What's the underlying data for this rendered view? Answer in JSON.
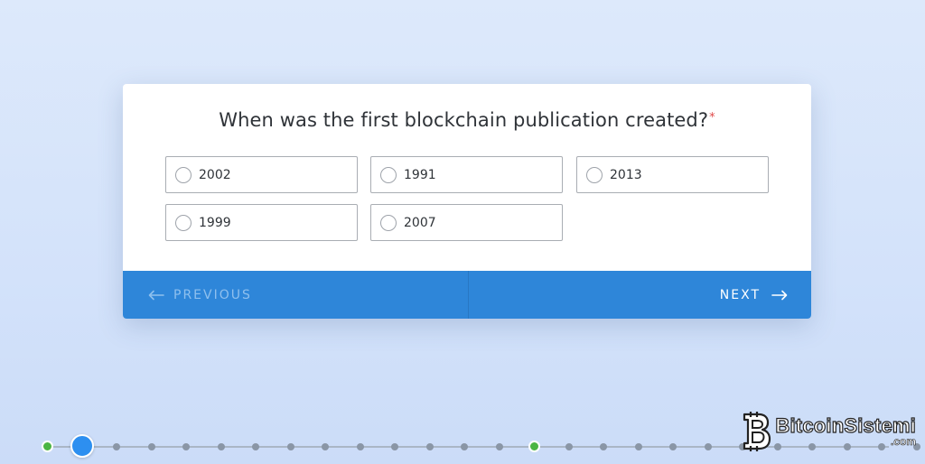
{
  "question": {
    "text": "When was the first blockchain publication created?",
    "required_mark": "*"
  },
  "options": [
    {
      "label": "2002",
      "selected": false
    },
    {
      "label": "1991",
      "selected": false
    },
    {
      "label": "2013",
      "selected": false
    },
    {
      "label": "1999",
      "selected": false
    },
    {
      "label": "2007",
      "selected": false
    }
  ],
  "footer": {
    "previous_label": "PREVIOUS",
    "next_label": "NEXT",
    "previous_icon": "arrow-left-icon",
    "next_icon": "arrow-right-icon"
  },
  "progress": {
    "steps": [
      "done",
      "active",
      "pending",
      "pending",
      "pending",
      "pending",
      "pending",
      "pending",
      "pending",
      "pending",
      "pending",
      "pending",
      "pending",
      "pending",
      "done",
      "pending",
      "pending",
      "pending",
      "pending",
      "pending",
      "pending",
      "pending",
      "pending",
      "pending",
      "pending",
      "pending"
    ]
  },
  "watermark": {
    "name": "BitcoinSistemi",
    "tld": ".com"
  },
  "colors": {
    "accent": "#2e86d9",
    "done": "#4bb543",
    "active": "#2d8ff0",
    "required": "#e04a4a"
  }
}
